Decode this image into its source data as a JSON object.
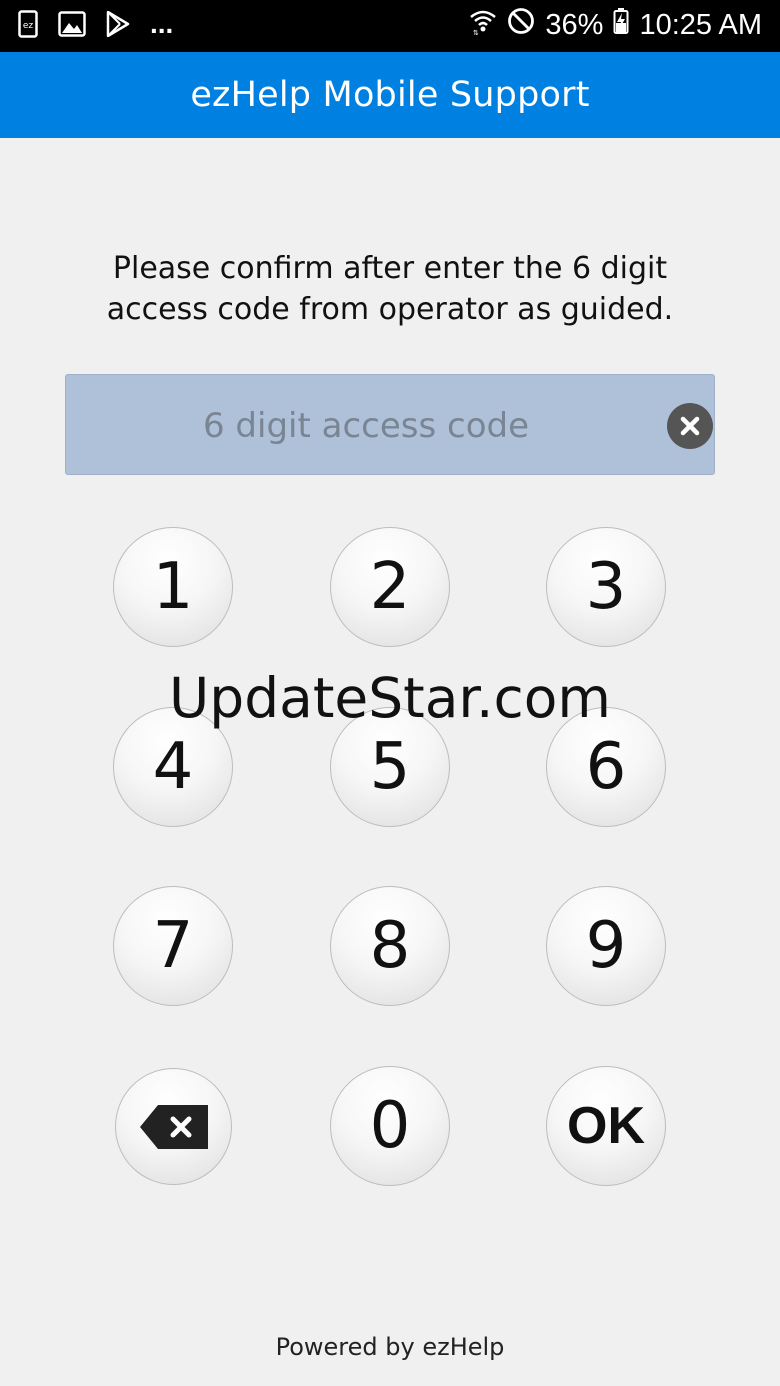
{
  "status_bar": {
    "ellipsis": "...",
    "battery": "36%",
    "time": "10:25 AM",
    "icons": [
      "ezhelp-notification-icon",
      "image-icon",
      "play-store-icon",
      "wifi-icon",
      "do-not-disturb-icon",
      "battery-charging-icon"
    ]
  },
  "app_bar": {
    "title": "ezHelp Mobile Support"
  },
  "instructions": {
    "line1": "Please confirm after enter the 6 digit",
    "line2": "access code from operator as guided."
  },
  "code_field": {
    "placeholder": "6 digit access code",
    "value": ""
  },
  "keypad": {
    "k1": "1",
    "k2": "2",
    "k3": "3",
    "k4": "4",
    "k5": "5",
    "k6": "6",
    "k7": "7",
    "k8": "8",
    "k9": "9",
    "k0": "0",
    "ok": "OK"
  },
  "watermark": "UpdateStar.com",
  "footer": "Powered by ezHelp",
  "colors": {
    "app_bar": "#0080e0",
    "field_bg": "#afc1d9",
    "page_bg": "#f0f0f0"
  }
}
